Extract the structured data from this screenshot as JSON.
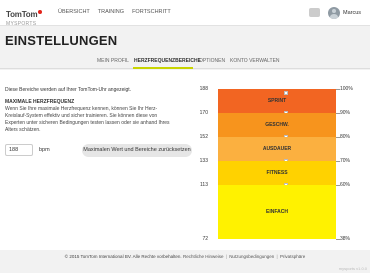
{
  "brand": {
    "name": "TomTom",
    "sub": "MYSPORTS"
  },
  "nav": {
    "items": [
      "ÜBERSICHT",
      "TRAINING",
      "FORTSCHRITT"
    ]
  },
  "user": {
    "name": "Marcus"
  },
  "page": {
    "title": "EINSTELLUNGEN"
  },
  "tabs": [
    "MEIN PROFIL",
    "HERZFREQUENZBEREICHE",
    "OPTIONEN",
    "KONTO VERWALTEN"
  ],
  "active_tab": "HERZFREQUENZBEREICHE",
  "content": {
    "intro": "Diese Bereiche werden auf Ihrer TomTom-Uhr angezeigt.",
    "max_hr_heading": "MAXIMALE HERZFREQUENZ",
    "max_hr_text": "Wenn Sie Ihre maximale Herzfrequenz kennen, können Sie Ihr Herz-Kreislauf-System effektiv und sicher trainieren. Sie können diese von Experten unter sicheren Bedingungen testen lassen oder sie anhand Ihres Alters schätzen.",
    "max_hr_value": "188",
    "unit": "bpm",
    "reset_button": "Maximalen Wert und Bereiche zurücksetzen"
  },
  "zones": {
    "max_hr": 188,
    "bounds": [
      "188",
      "170",
      "152",
      "133",
      "113",
      "72"
    ],
    "percent_bounds": [
      "100%",
      "90%",
      "80%",
      "70%",
      "60%",
      "38%"
    ],
    "bands": [
      {
        "name": "SPRINT",
        "from": 170,
        "to": 188,
        "color": "#f26522"
      },
      {
        "name": "GESCHW.",
        "from": 152,
        "to": 170,
        "color": "#f7941d"
      },
      {
        "name": "AUSDAUER",
        "from": 133,
        "to": 152,
        "color": "#fbb040"
      },
      {
        "name": "FITNESS",
        "from": 113,
        "to": 133,
        "color": "#ffd200"
      },
      {
        "name": "EINFACH",
        "from": 72,
        "to": 113,
        "color": "#fff200"
      }
    ]
  },
  "footer": {
    "copyright": "© 2015 TomTom International BV. Alle Rechte vorbehalten.",
    "links": [
      "Rechtliche Hinweise",
      "Nutzungsbedingungen",
      "Privatsphäre"
    ],
    "build": "mysports v1.0.0"
  }
}
